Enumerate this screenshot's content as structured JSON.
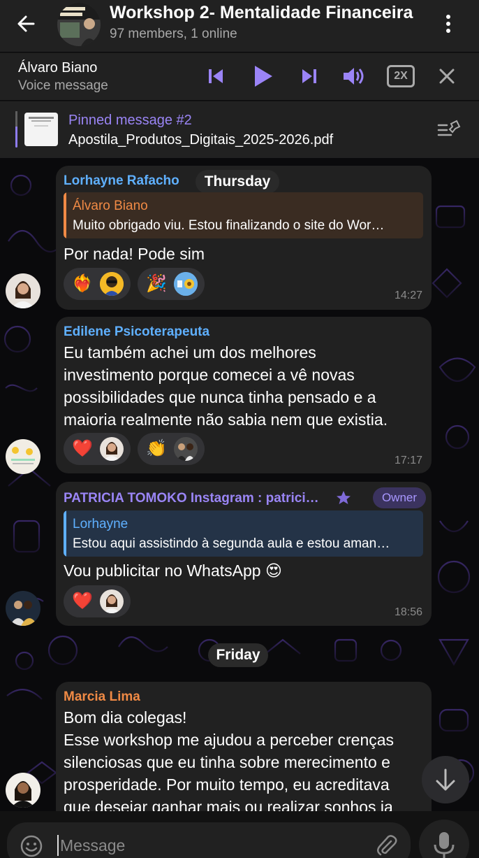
{
  "header": {
    "title": "Workshop 2- Mentalidade Financeira",
    "subtitle": "97 members, 1 online",
    "avatar_text": "MENTALIDADE FINANCEIRA"
  },
  "player": {
    "name": "Álvaro Biano",
    "subtitle": "Voice message",
    "speed": "2X"
  },
  "pinned": {
    "title": "Pinned message #2",
    "text": "Apostila_Produtos_Digitais_2025-2026.pdf"
  },
  "days": {
    "thursday": "Thursday",
    "friday": "Friday"
  },
  "messages": [
    {
      "sender": "Lorhayne Rafacho",
      "reply_name": "Álvaro Biano",
      "reply_text": "Muito obrigado viu. Estou finalizando o site do Wor…",
      "text": "Por nada! Pode sim",
      "reactions": [
        {
          "emoji": "❤️‍🔥"
        },
        {
          "emoji": "🎉"
        }
      ],
      "time": "14:27"
    },
    {
      "sender": "Edilene Psicoterapeuta",
      "text": "Eu também achei um dos melhores\ninvestimento porque comecei a vê novas\npossibilidades que nunca tinha pensado e a\nmaioria realmente não sabia nem que existia.",
      "reactions": [
        {
          "emoji": "❤️"
        },
        {
          "emoji": "👏"
        }
      ],
      "time": "17:17"
    },
    {
      "sender": "PATRICIA TOMOKO Instagram : patrici…",
      "badge": "Owner",
      "reply_name": "Lorhayne",
      "reply_text": "Estou aqui assistindo à segunda aula e estou aman…",
      "text": "Vou publicitar no WhatsApp 😍",
      "reactions": [
        {
          "emoji": "❤️"
        }
      ],
      "time": "18:56"
    },
    {
      "sender": "Marcia Lima",
      "text": "Bom dia colegas!\nEsse workshop me ajudou a perceber crenças\nsilenciosas que eu tinha sobre merecimento e\nprosperidade. Por muito tempo, eu acreditava\nque desejar ganhar mais ou realizar sonhos ia"
    }
  ],
  "composer": {
    "placeholder": "Message"
  },
  "colors": {
    "accent": "#8e7cf0",
    "sender_blue": "#5fb0ff",
    "sender_purple": "#9a85f5",
    "sender_orange": "#f08a45"
  }
}
